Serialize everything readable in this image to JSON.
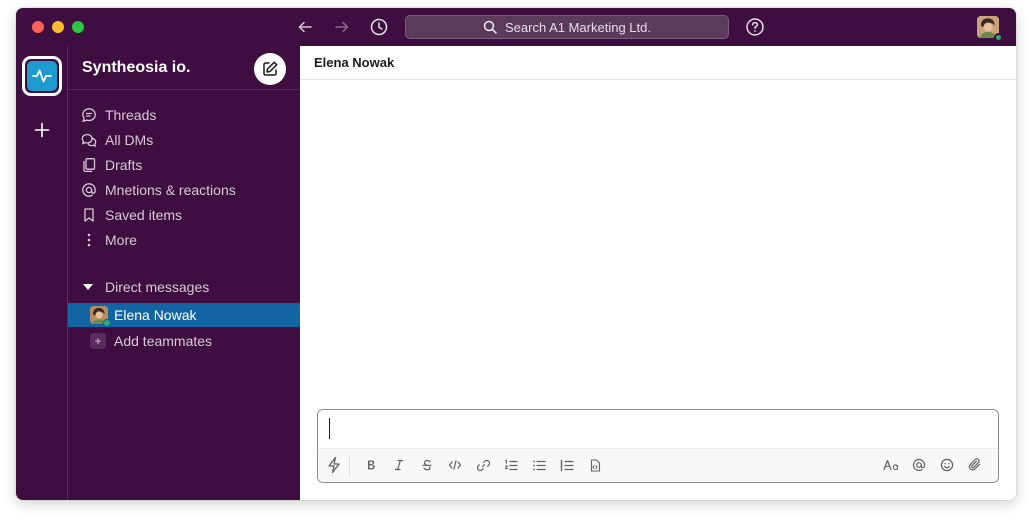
{
  "titlebar": {
    "search_placeholder": "Search A1 Marketing Ltd.",
    "back_icon": "arrow-left-icon",
    "forward_icon": "arrow-right-icon",
    "history_icon": "clock-icon",
    "help_icon": "help-circle-icon"
  },
  "workspace": {
    "name": "Syntheosia io.",
    "accent": "#1d9bd1"
  },
  "sidebar": {
    "items": [
      {
        "label": "Threads",
        "icon": "threads-icon"
      },
      {
        "label": "All DMs",
        "icon": "all-dms-icon"
      },
      {
        "label": "Drafts",
        "icon": "drafts-icon"
      },
      {
        "label": "Mnetions & reactions",
        "icon": "at-sign-icon"
      },
      {
        "label": "Saved items",
        "icon": "bookmark-icon"
      },
      {
        "label": "More",
        "icon": "more-vertical-icon"
      }
    ],
    "dm_section_label": "Direct messages",
    "dms": [
      {
        "label": "Elena Nowak",
        "status": "active"
      }
    ],
    "add_teammates_label": "Add teammates"
  },
  "channel": {
    "title": "Elena Nowak"
  },
  "composer": {
    "value": "",
    "toolbar_icons": [
      "shortcuts-icon",
      "bold-icon",
      "italic-icon",
      "strikethrough-icon",
      "code-icon",
      "link-icon",
      "ordered-list-icon",
      "bulleted-list-icon",
      "blockquote-icon",
      "code-block-icon",
      "text-format-icon",
      "mention-icon",
      "emoji-icon",
      "attachment-icon"
    ]
  },
  "colors": {
    "aubergine": "#3f0e40",
    "active_item": "#1264a3",
    "presence": "#2bac76"
  }
}
